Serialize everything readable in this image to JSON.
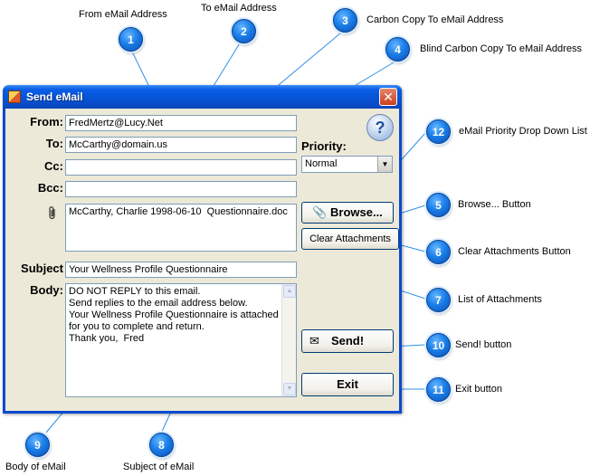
{
  "window": {
    "title": "Send eMail",
    "close_glyph": "✕"
  },
  "form": {
    "from_label": "From:",
    "from_value": "FredMertz@Lucy.Net",
    "to_label": "To:",
    "to_value": "McCarthy@domain.us",
    "cc_label": "Cc:",
    "cc_value": "",
    "bcc_label": "Bcc:",
    "bcc_value": "",
    "attachment_icon": "paperclip-icon",
    "attachments": [
      "McCarthy, Charlie 1998-06-10  Questionnaire.doc"
    ],
    "subject_label": "Subject",
    "subject_value": "Your Wellness Profile Questionnaire",
    "body_label": "Body:",
    "body_lines": [
      "DO NOT REPLY to this email.",
      "Send replies to the email address below.",
      "",
      "Your Wellness Profile Questionnaire is attached",
      "for you to complete and return.",
      "",
      "Thank you,  Fred"
    ]
  },
  "side": {
    "help_glyph": "?",
    "priority_label": "Priority:",
    "priority_value": "Normal",
    "browse_label": "Browse...",
    "browse_icon": "paperclip-icon",
    "clear_label": "Clear Attachments",
    "send_label": "Send!",
    "send_icon": "mail-send-icon",
    "exit_label": "Exit"
  },
  "callouts": [
    {
      "number": "1",
      "text": "From eMail Address"
    },
    {
      "number": "2",
      "text": "To eMail Address"
    },
    {
      "number": "3",
      "text": "Carbon Copy To eMail Address"
    },
    {
      "number": "4",
      "text": "Blind Carbon Copy To eMail Address"
    },
    {
      "number": "5",
      "text": "Browse... Button"
    },
    {
      "number": "6",
      "text": "Clear Attachments Button"
    },
    {
      "number": "7",
      "text": "List of Attachments"
    },
    {
      "number": "8",
      "text": "Subject of eMail"
    },
    {
      "number": "9",
      "text": "Body of eMail"
    },
    {
      "number": "10",
      "text": "Send! button"
    },
    {
      "number": "11",
      "text": "Exit button"
    },
    {
      "number": "12",
      "text": "eMail Priority Drop Down List"
    }
  ],
  "colors": {
    "callout_blue": "#1a7ee8",
    "leader_line": "#2f8fe8",
    "titlebar": "#0553d6",
    "dialog_face": "#ece9d8"
  }
}
